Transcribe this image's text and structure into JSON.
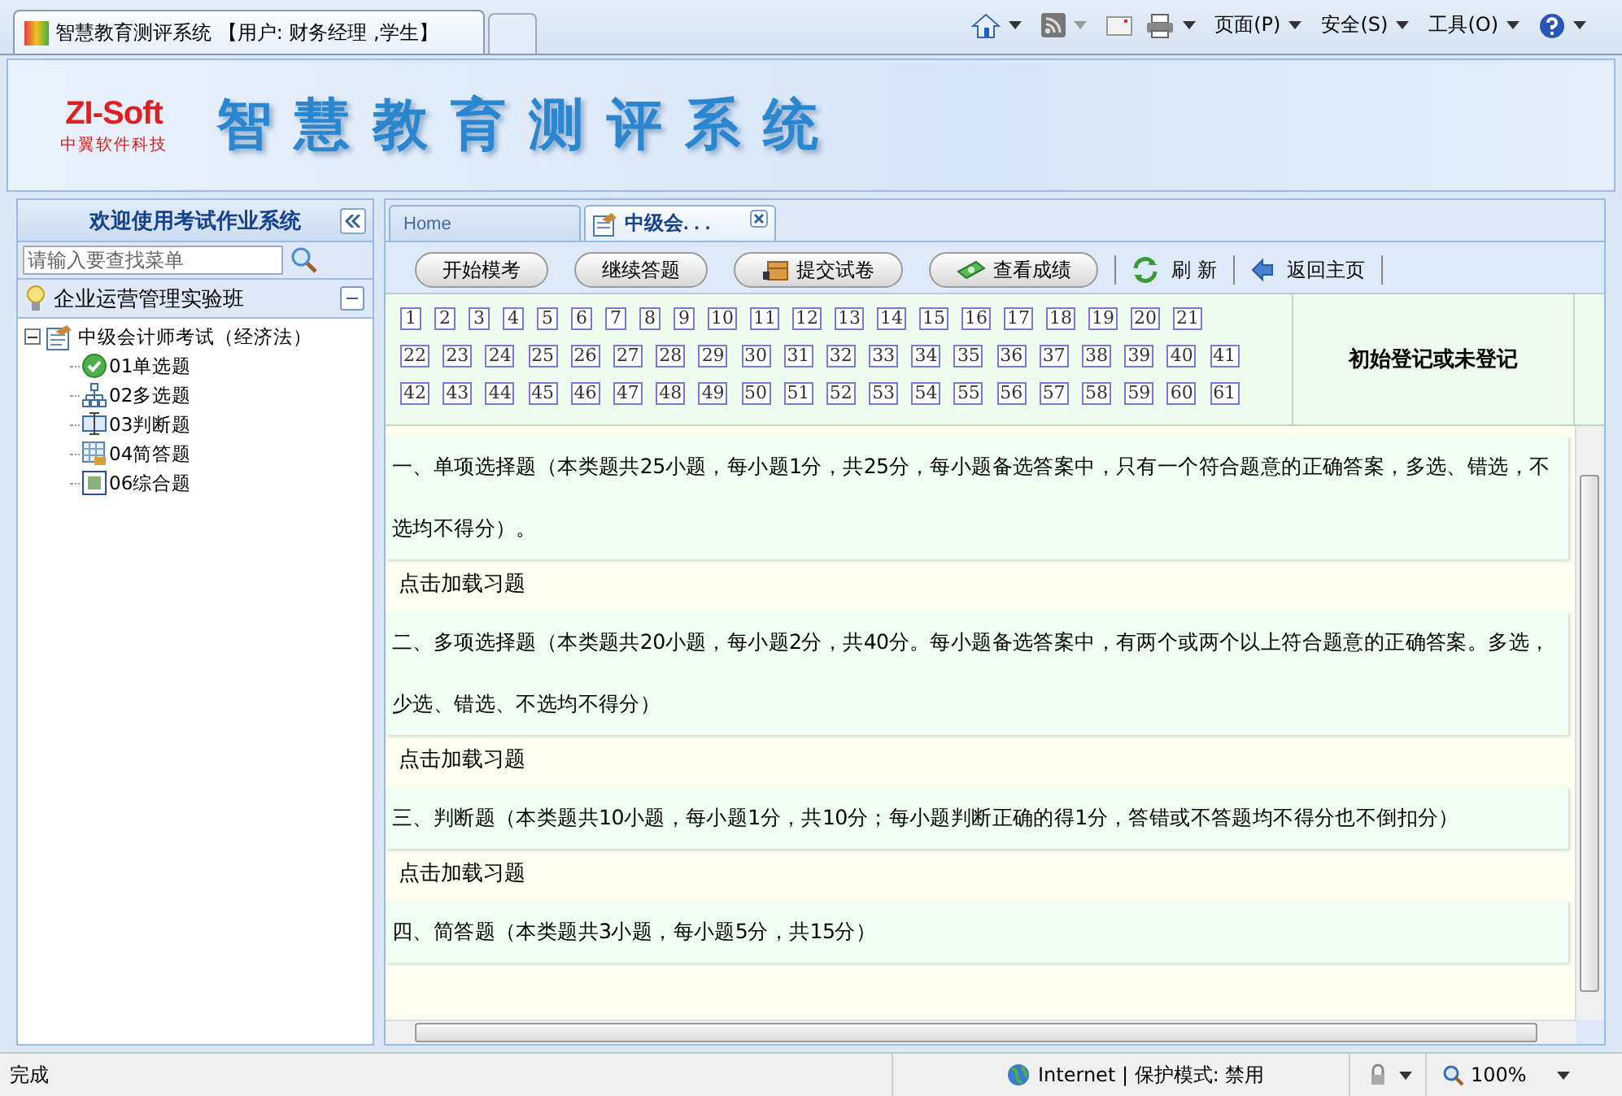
{
  "browser": {
    "tab_title": "智慧教育测评系统 【用户: 财务经理 ,学生】",
    "menus": [
      "页面(P)",
      "安全(S)",
      "工具(O)"
    ]
  },
  "banner": {
    "logo": "ZI-Soft",
    "logo_subtitle": "中翼软件科技",
    "title": "智慧教育测评系统"
  },
  "sidebar": {
    "title": "欢迎使用考试作业系统",
    "search": {
      "placeholder": "请输入要查找菜单"
    },
    "group": {
      "label": "企业运营管理实验班",
      "expanded": true
    },
    "tree": [
      {
        "label": "中级会计师考试（经济法）",
        "expanded": true,
        "children": [
          {
            "label": "01单选题",
            "kind": "check"
          },
          {
            "label": "02多选题",
            "kind": "hierarchy"
          },
          {
            "label": "03判断题",
            "kind": "monitor"
          },
          {
            "label": "04简答题",
            "kind": "table"
          },
          {
            "label": "06综合题",
            "kind": "picture"
          }
        ]
      }
    ]
  },
  "tabs": [
    {
      "label": "Home",
      "selected": false,
      "closable": false
    },
    {
      "label": "中级会. . .",
      "selected": true,
      "closable": true
    }
  ],
  "toolbar": [
    {
      "label": "开始模考",
      "kind": "pill"
    },
    {
      "label": "继续答题",
      "kind": "pill"
    },
    {
      "label": "提交试卷",
      "kind": "pill-box"
    },
    {
      "label": "查看成绩",
      "kind": "pill-money"
    },
    {
      "label": "刷 新",
      "kind": "refresh"
    },
    {
      "label": "返回主页",
      "kind": "back"
    }
  ],
  "question_rows": [
    [
      "1",
      "2",
      "3",
      "4",
      "5",
      "6",
      "7",
      "8",
      "9",
      "10",
      "11",
      "12",
      "13",
      "14",
      "15",
      "16",
      "17",
      "18",
      "19",
      "20",
      "21"
    ],
    [
      "22",
      "23",
      "24",
      "25",
      "26",
      "27",
      "28",
      "29",
      "30",
      "31",
      "32",
      "33",
      "34",
      "35",
      "36",
      "37",
      "38",
      "39",
      "40",
      "41"
    ],
    [
      "42",
      "43",
      "44",
      "45",
      "46",
      "47",
      "48",
      "49",
      "50",
      "51",
      "52",
      "53",
      "54",
      "55",
      "56",
      "57",
      "58",
      "59",
      "60",
      "61"
    ]
  ],
  "register_status": "初始登记或未登记",
  "sections": [
    {
      "heading": "一、单项选择题（本类题共25小题，每小题1分，共25分，每小题备选答案中，只有一个符合题意的正确答案，多选、错选，不选均不得分）。",
      "link": "点击加载习题"
    },
    {
      "heading": "二、多项选择题（本类题共20小题，每小题2分，共40分。每小题备选答案中，有两个或两个以上符合题意的正确答案。多选，少选、错选、不选均不得分）",
      "link": "点击加载习题"
    },
    {
      "heading": "三、判断题（本类题共10小题，每小题1分，共10分；每小题判断正确的得1分，答错或不答题均不得分也不倒扣分）",
      "link": "点击加载习题"
    },
    {
      "heading": "四、简答题（本类题共3小题，每小题5分，共15分）"
    }
  ],
  "status_bar": {
    "text": "完成",
    "zone": "Internet | 保护模式: 禁用",
    "zoom": "100%"
  }
}
